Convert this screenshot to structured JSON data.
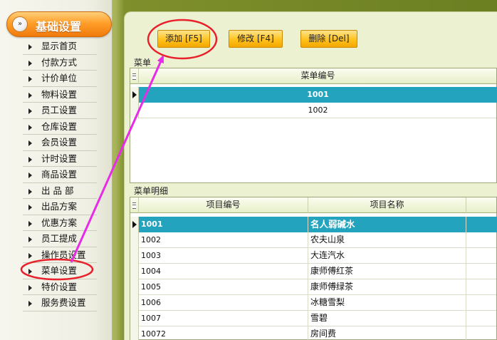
{
  "sidebar": {
    "title": "基础设置",
    "header_icon_glyph": "»",
    "items": [
      {
        "label": "显示首页"
      },
      {
        "label": "付款方式"
      },
      {
        "label": "计价单位"
      },
      {
        "label": "物料设置"
      },
      {
        "label": "员工设置"
      },
      {
        "label": "仓库设置"
      },
      {
        "label": "会员设置"
      },
      {
        "label": "计时设置"
      },
      {
        "label": "商品设置"
      },
      {
        "label": "出 品 部"
      },
      {
        "label": "出品方案"
      },
      {
        "label": "优惠方案"
      },
      {
        "label": "员工提成"
      },
      {
        "label": "操作员设置"
      },
      {
        "label": "菜单设置"
      },
      {
        "label": "特价设置"
      },
      {
        "label": "服务费设置"
      }
    ]
  },
  "toolbar": {
    "add_label": "添加 [F5]",
    "edit_label": "修改 [F4]",
    "delete_label": "删除 [Del]"
  },
  "menu_section": {
    "label": "菜单",
    "column_header": "菜单编号",
    "rows": [
      {
        "code": "1001"
      },
      {
        "code": "1002"
      }
    ]
  },
  "detail_section": {
    "label": "菜单明细",
    "columns": [
      "项目编号",
      "项目名称"
    ],
    "rows": [
      {
        "code": "1001",
        "name": "名人弱碱水"
      },
      {
        "code": "1002",
        "name": "农夫山泉"
      },
      {
        "code": "1003",
        "name": "大连汽水"
      },
      {
        "code": "1004",
        "name": "康师傅红茶"
      },
      {
        "code": "1005",
        "name": "康师傅绿茶"
      },
      {
        "code": "1006",
        "name": "冰糖雪梨"
      },
      {
        "code": "1007",
        "name": "雪碧"
      },
      {
        "code": "10072",
        "name": "房间费"
      }
    ]
  },
  "colors": {
    "selected_row": "#23a3bd",
    "annotation_circle": "#e8212b",
    "annotation_arrow": "#e62ce6",
    "button_fill": "#ffc21c",
    "nav_header": "#ff9f2a"
  }
}
